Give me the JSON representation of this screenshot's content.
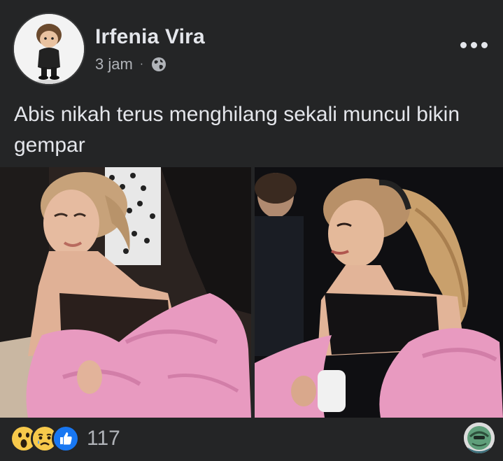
{
  "post": {
    "author": "Irfenia Vira",
    "time": "3 jam",
    "separator": "·",
    "privacy_icon": "globe-icon",
    "more_icon": "more-dots-icon",
    "text": "Abis nikah terus menghilang sekali muncul bikin gempar"
  },
  "photos": [
    {
      "name": "photo-left",
      "icon": "photo"
    },
    {
      "name": "photo-right",
      "icon": "photo"
    }
  ],
  "reactions": {
    "icons": [
      "wow-reaction-icon",
      "sad-reaction-icon",
      "like-reaction-icon"
    ],
    "count": "117"
  },
  "colors": {
    "background": "#242526",
    "text_primary": "#e4e6eb",
    "text_secondary": "#b0b3b8",
    "like_blue": "#1877f2",
    "reaction_yellow": "#f7c94b",
    "jacket_pink": "#e89ac0"
  }
}
